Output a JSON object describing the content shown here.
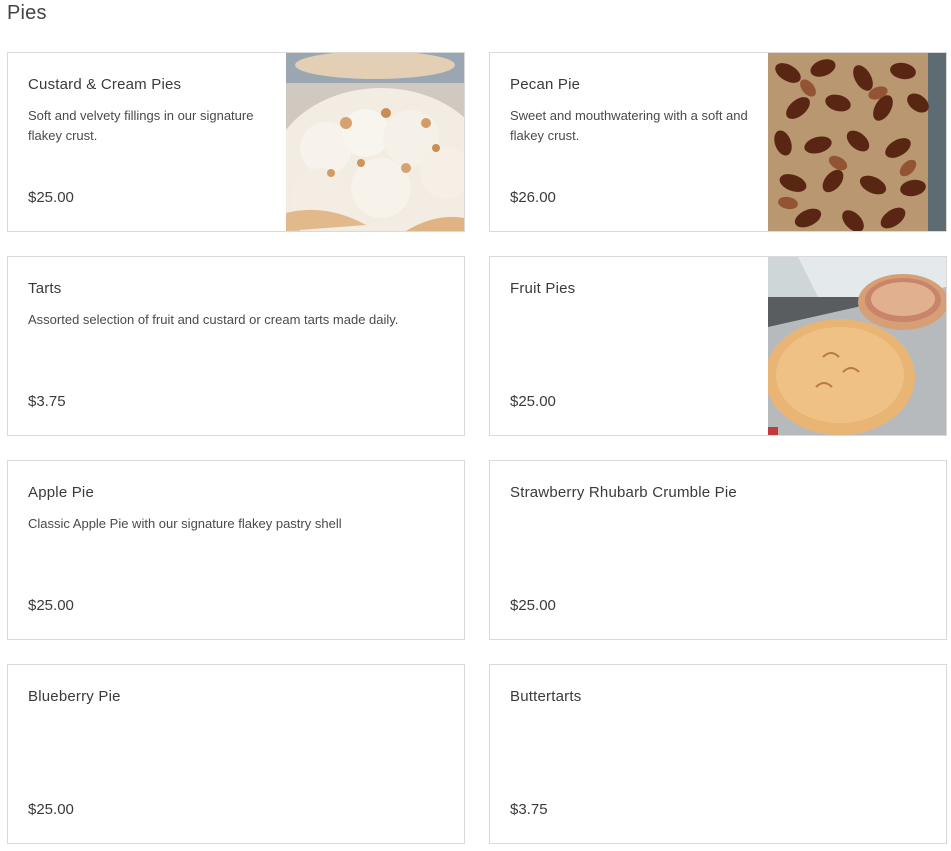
{
  "section": {
    "title": "Pies"
  },
  "items": [
    {
      "name": "Custard & Cream Pies",
      "description": "Soft and velvety fillings in our signature flakey crust.",
      "price": "$25.00",
      "image": "cream-pie-photo"
    },
    {
      "name": "Pecan Pie",
      "description": "Sweet and mouthwatering with a soft and flakey crust.",
      "price": "$26.00",
      "image": "pecans-photo"
    },
    {
      "name": "Tarts",
      "description": "Assorted selection of fruit and custard or cream tarts made daily.",
      "price": "$3.75"
    },
    {
      "name": "Fruit Pies",
      "description": "",
      "price": "$25.00",
      "image": "fruit-pies-photo"
    },
    {
      "name": "Apple Pie",
      "description": "Classic Apple Pie with our signature flakey pastry shell",
      "price": "$25.00"
    },
    {
      "name": "Strawberry Rhubarb Crumble Pie",
      "description": "",
      "price": "$25.00"
    },
    {
      "name": "Blueberry Pie",
      "description": "",
      "price": "$25.00"
    },
    {
      "name": "Buttertarts",
      "description": "",
      "price": "$3.75"
    }
  ],
  "colors": {
    "border": "#d9d9d9",
    "text": "#3a3a3a",
    "background": "#ffffff"
  }
}
